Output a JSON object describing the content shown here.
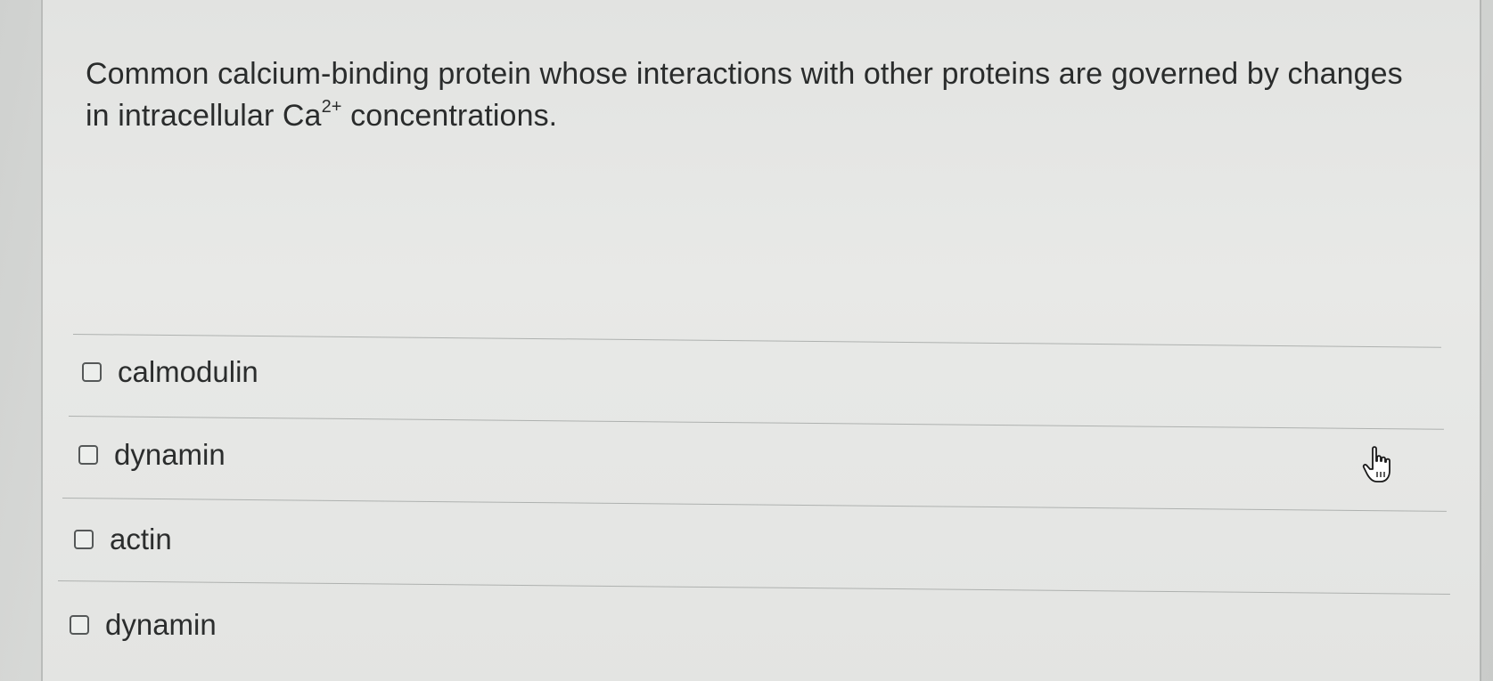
{
  "question": {
    "text_before": "Common calcium-binding protein whose interactions with other proteins are governed by changes in intracellular Ca",
    "superscript": "2+",
    "text_after": " concentrations."
  },
  "options": [
    {
      "label": "calmodulin",
      "checked": false
    },
    {
      "label": "dynamin",
      "checked": false
    },
    {
      "label": "actin",
      "checked": false
    },
    {
      "label": "dynamin",
      "checked": false
    }
  ],
  "cursor": {
    "icon": "hand-pointer-icon"
  }
}
